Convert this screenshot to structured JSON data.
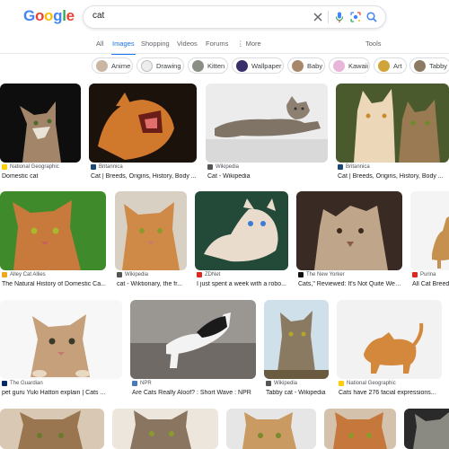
{
  "logo": {
    "letters": [
      "G",
      "o",
      "o",
      "g",
      "l",
      "e"
    ],
    "colors": [
      "#4285f4",
      "#ea4335",
      "#fbbc05",
      "#4285f4",
      "#34a853",
      "#ea4335"
    ]
  },
  "search": {
    "query": "cat"
  },
  "tabs": {
    "all": "All",
    "images": "Images",
    "shopping": "Shopping",
    "videos": "Videos",
    "forums": "Forums",
    "more": "More",
    "tools": "Tools"
  },
  "chips": [
    {
      "label": "Anime"
    },
    {
      "label": "Drawing"
    },
    {
      "label": "Kitten"
    },
    {
      "label": "Wallpaper"
    },
    {
      "label": "Baby"
    },
    {
      "label": "Kawaii"
    },
    {
      "label": "Art"
    },
    {
      "label": "Tabby"
    }
  ],
  "results": [
    {
      "source": "National Geographic",
      "caption": "Domestic cat"
    },
    {
      "source": "Britannica",
      "caption": "Cat | Breeds, Origins, History, Body ..."
    },
    {
      "source": "Wikipedia",
      "caption": "Cat - Wikipedia"
    },
    {
      "source": "Britannica",
      "caption": "Cat | Breeds, Origins, History, Body ..."
    },
    {
      "source": "Alley Cat Allies",
      "caption": "The Natural History of Domestic Ca..."
    },
    {
      "source": "Wikipedia",
      "caption": "cat - Wiktionary, the fr..."
    },
    {
      "source": "ZDNet",
      "caption": "I just spent a week with a robo..."
    },
    {
      "source": "The New Yorker",
      "caption": "Cats,\" Reviewed: It's Not Quite Weir..."
    },
    {
      "source": "Purina",
      "caption": "All Cat Breeds"
    },
    {
      "source": "The Guardian",
      "caption": "pet guru Yuki Hattori explain | Cats ..."
    },
    {
      "source": "NPR",
      "caption": "Are Cats Really Aloof? : Short Wave : NPR"
    },
    {
      "source": "Wikipedia",
      "caption": "Tabby cat - Wikipedia"
    },
    {
      "source": "National Geographic",
      "caption": "Cats have 276 facial expressions..."
    }
  ],
  "colors": {
    "accent": "#1a73e8",
    "text": "#202124",
    "muted": "#5f6368"
  },
  "icons": {
    "clear": "close-icon",
    "voice": "mic-icon",
    "lens": "lens-icon",
    "search": "search-icon",
    "more": "more-vert-icon"
  }
}
